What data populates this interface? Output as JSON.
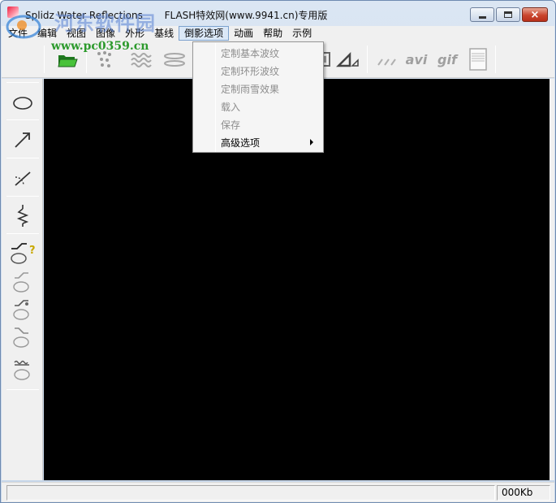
{
  "window": {
    "title": "Splidz Water Reflections",
    "title_suffix": "FLASH特效网(www.9941.cn)专用版",
    "minimize_label": "minimize",
    "maximize_label": "maximize",
    "close_label": "×"
  },
  "watermark": {
    "text": "河东软件园",
    "url": "www.pc0359.cn"
  },
  "menubar": {
    "items": [
      {
        "label": "文件"
      },
      {
        "label": "编辑"
      },
      {
        "label": "视图"
      },
      {
        "label": "图像"
      },
      {
        "label": "外形"
      },
      {
        "label": "基线"
      },
      {
        "label": "倒影选项",
        "active": true
      },
      {
        "label": "动画"
      },
      {
        "label": "帮助"
      },
      {
        "label": "示例"
      }
    ]
  },
  "toolbar": {
    "avi_label": "avi",
    "gif_label": "gif"
  },
  "dropdown": {
    "items": [
      {
        "label": "定制基本波纹",
        "enabled": false
      },
      {
        "label": "定制环形波纹",
        "enabled": false
      },
      {
        "label": "定制雨雪效果",
        "enabled": false
      },
      {
        "label": "载入",
        "enabled": false
      },
      {
        "label": "保存",
        "enabled": false
      },
      {
        "label": "高级选项",
        "enabled": true,
        "submenu": true
      }
    ]
  },
  "statusbar": {
    "size": "000Kb"
  },
  "colors": {
    "canvas": "#000000",
    "chrome": "#f0f0f0",
    "disabled_text": "#8d8d8d",
    "close_button": "#c9452d"
  }
}
